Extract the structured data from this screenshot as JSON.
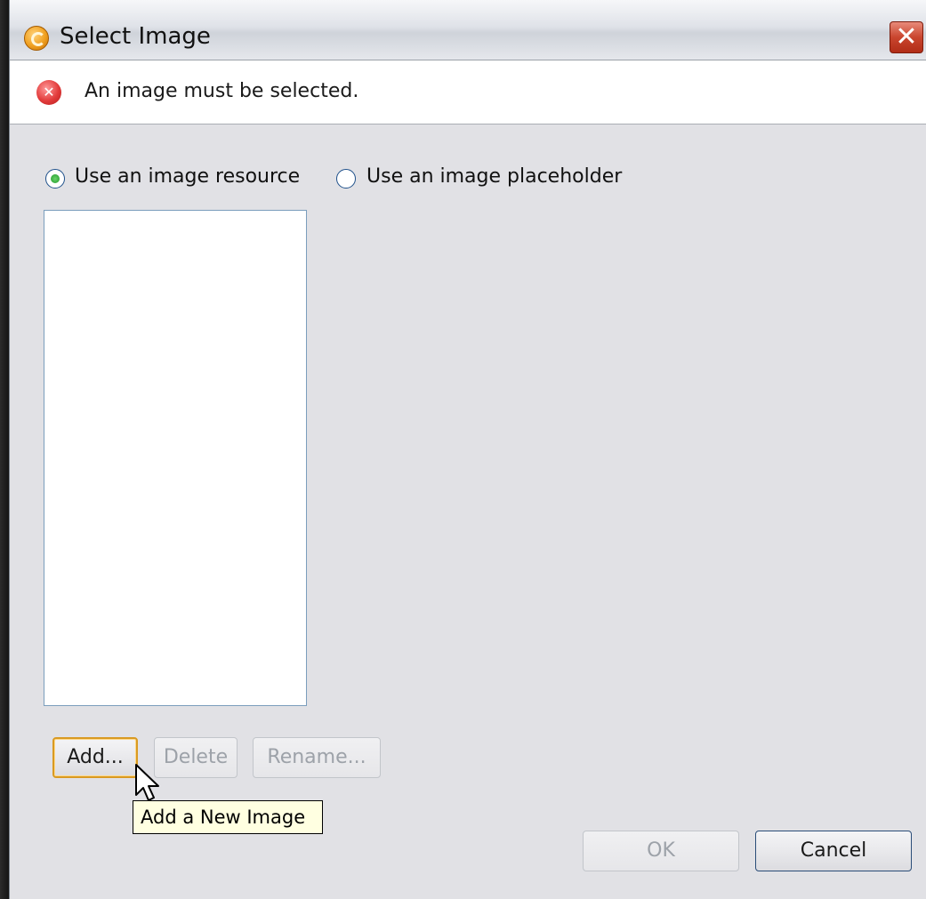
{
  "dialog": {
    "title": "Select Image",
    "close_glyph": "✕",
    "app_icon": "app-logo-icon"
  },
  "message": {
    "icon": "error-icon",
    "icon_glyph": "✕",
    "text": "An image must be selected."
  },
  "options": {
    "resource_label": "Use an image resource",
    "resource_selected": true,
    "placeholder_label": "Use an image placeholder",
    "placeholder_selected": false
  },
  "image_list": {
    "items": []
  },
  "buttons": {
    "add": "Add...",
    "delete": "Delete",
    "rename": "Rename...",
    "ok": "OK",
    "cancel": "Cancel"
  },
  "tooltip": {
    "text": "Add a New Image"
  }
}
